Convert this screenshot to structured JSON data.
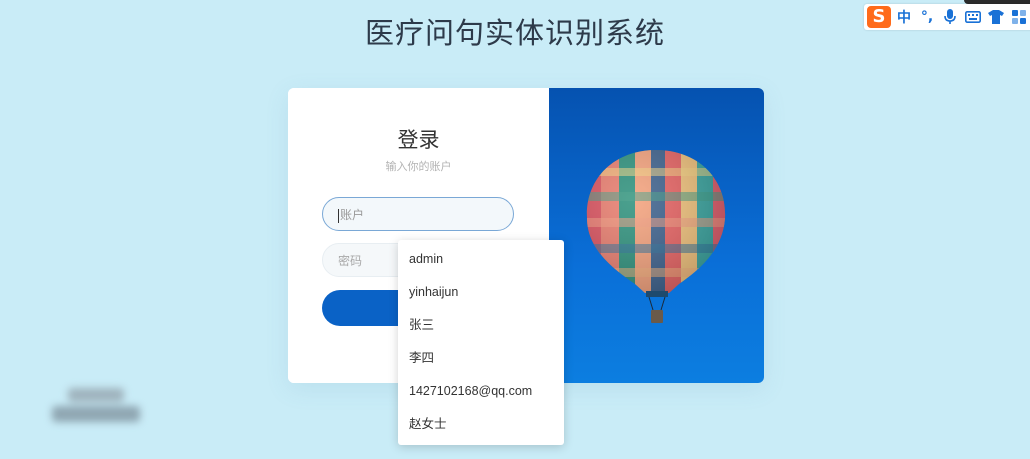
{
  "app": {
    "title": "医疗问句实体识别系统"
  },
  "ime_toolbar": {
    "logo": "S",
    "items": [
      {
        "icon": "chinese-mode-icon",
        "glyph": "中"
      },
      {
        "icon": "punctuation-icon",
        "glyph": "°,"
      },
      {
        "icon": "microphone-icon",
        "glyph": "🎙"
      },
      {
        "icon": "keyboard-icon",
        "glyph": "⌨"
      },
      {
        "icon": "skin-icon",
        "glyph": "👕"
      },
      {
        "icon": "toolbox-icon",
        "glyph": "▦"
      }
    ]
  },
  "login": {
    "heading": "登录",
    "subtitle": "输入你的账户",
    "account_placeholder": "账户",
    "password_placeholder": "密码"
  },
  "autocomplete": {
    "items": [
      "admin",
      "yinhaijun",
      "张三",
      "李四",
      "1427102168@qq.com",
      "赵女士"
    ]
  },
  "colors": {
    "background": "#c9ecf7",
    "button": "#0a62c6",
    "image_blue": "#0a6fd8"
  }
}
